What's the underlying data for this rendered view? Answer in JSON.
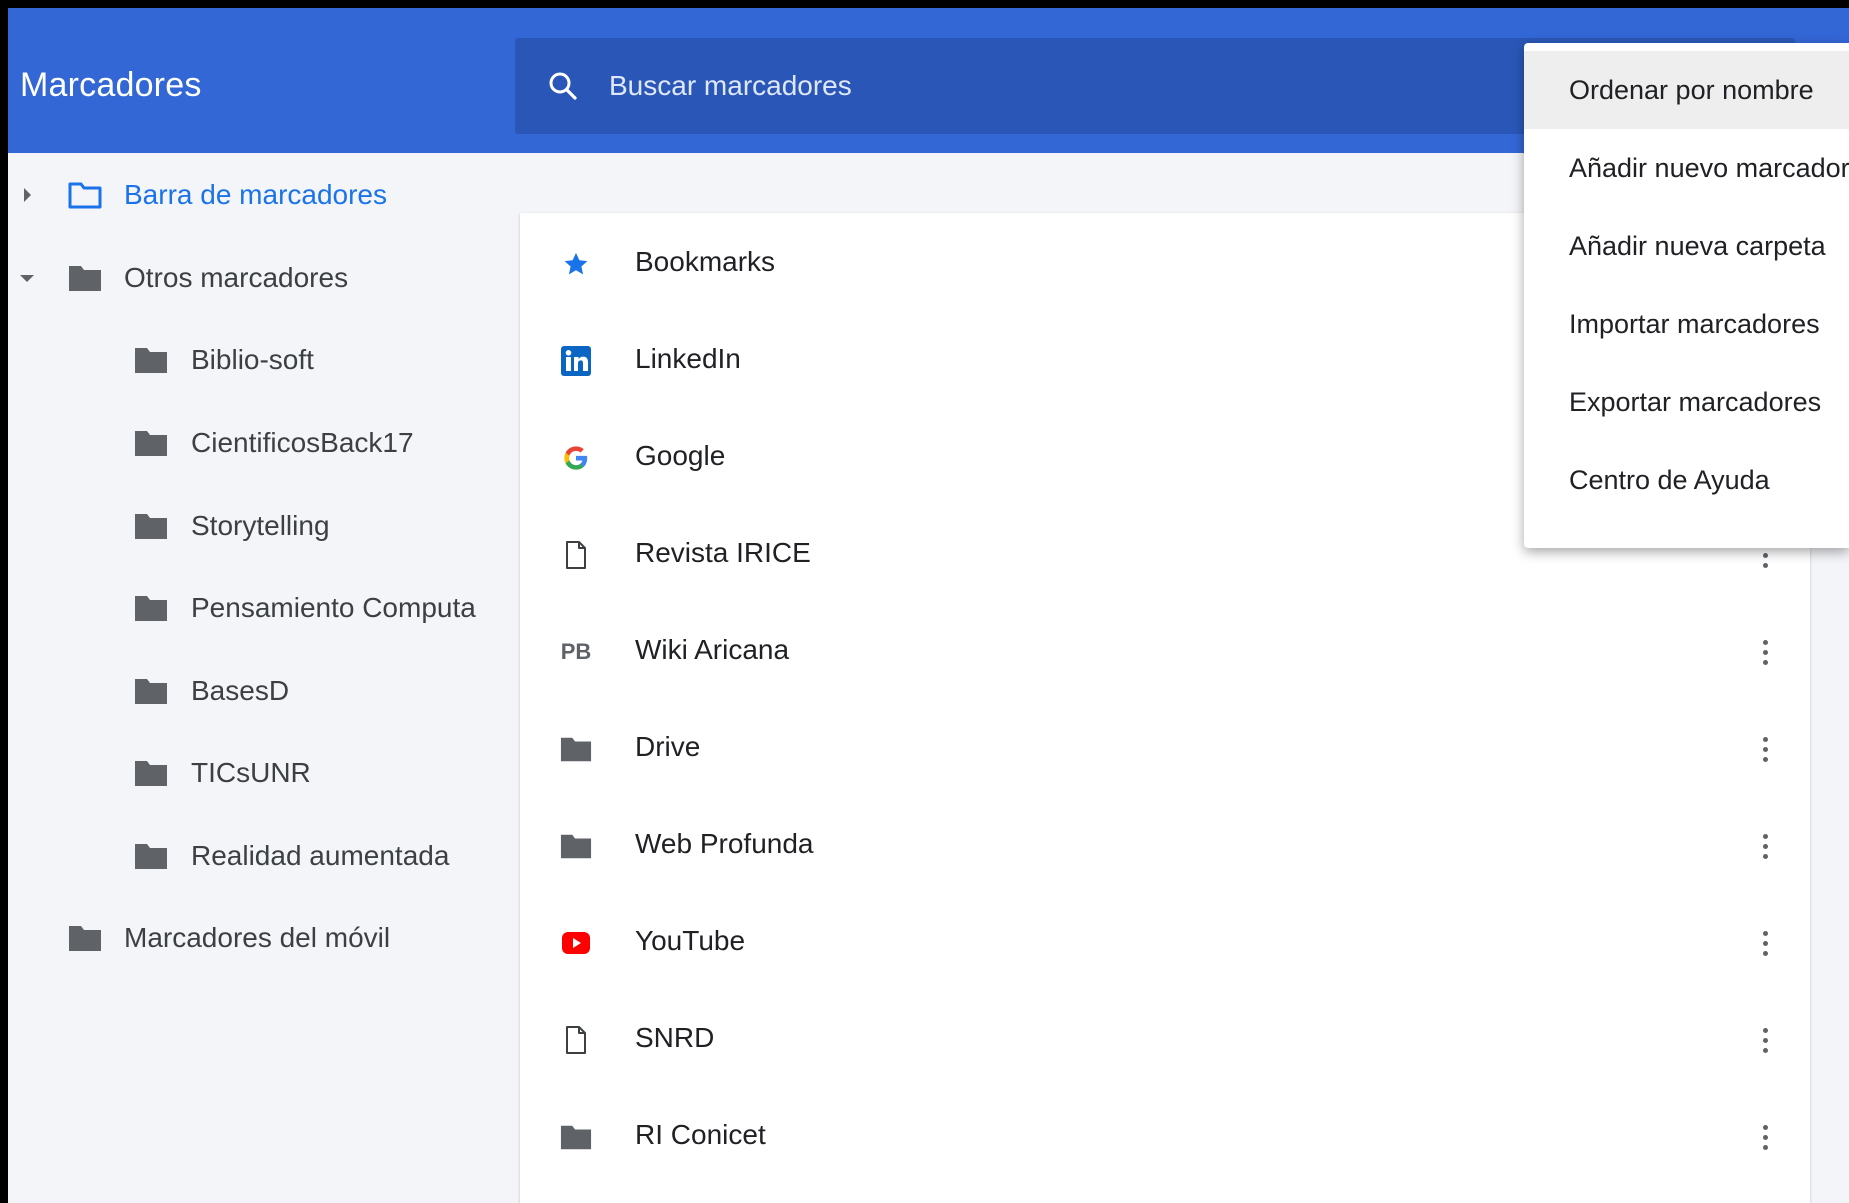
{
  "app": {
    "title": "Marcadores"
  },
  "search": {
    "placeholder": "Buscar marcadores",
    "value": ""
  },
  "sidebar": {
    "items": [
      {
        "label": "Barra de marcadores",
        "level": 0,
        "expanded": false,
        "selected": true
      },
      {
        "label": "Otros marcadores",
        "level": 0,
        "expanded": true,
        "selected": false
      },
      {
        "label": "Biblio-soft",
        "level": 1
      },
      {
        "label": "CientificosBack17",
        "level": 1
      },
      {
        "label": "Storytelling",
        "level": 1
      },
      {
        "label": "Pensamiento Computa",
        "level": 1
      },
      {
        "label": "BasesD",
        "level": 1
      },
      {
        "label": "TICsUNR",
        "level": 1
      },
      {
        "label": "Realidad aumentada",
        "level": 1
      },
      {
        "label": "Marcadores del móvil",
        "level": 0
      }
    ]
  },
  "list": {
    "items": [
      {
        "title": "Bookmarks",
        "icon": "star-icon"
      },
      {
        "title": "LinkedIn",
        "icon": "linkedin-icon"
      },
      {
        "title": "Google",
        "icon": "google-icon"
      },
      {
        "title": "Revista IRICE",
        "icon": "page-icon"
      },
      {
        "title": "Wiki Aricana",
        "icon": "pb-icon",
        "icon_text": "PB"
      },
      {
        "title": "Drive",
        "icon": "folder-icon"
      },
      {
        "title": "Web Profunda",
        "icon": "folder-icon"
      },
      {
        "title": "YouTube",
        "icon": "youtube-icon"
      },
      {
        "title": "SNRD",
        "icon": "page-icon"
      },
      {
        "title": "RI Conicet",
        "icon": "folder-icon"
      }
    ]
  },
  "menu": {
    "items": [
      {
        "label": "Ordenar por nombre",
        "highlighted": true
      },
      {
        "label": "Añadir nuevo marcador"
      },
      {
        "label": "Añadir nueva carpeta"
      },
      {
        "label": "Importar marcadores"
      },
      {
        "label": "Exportar marcadores"
      },
      {
        "label": "Centro de Ayuda"
      }
    ]
  },
  "colors": {
    "header": "#3367d6",
    "search_bg": "#2a57b7",
    "selected_text": "#1a73e8",
    "star": "#1a73e8",
    "linkedin": "#0a66c2",
    "youtube": "#ff0000"
  }
}
